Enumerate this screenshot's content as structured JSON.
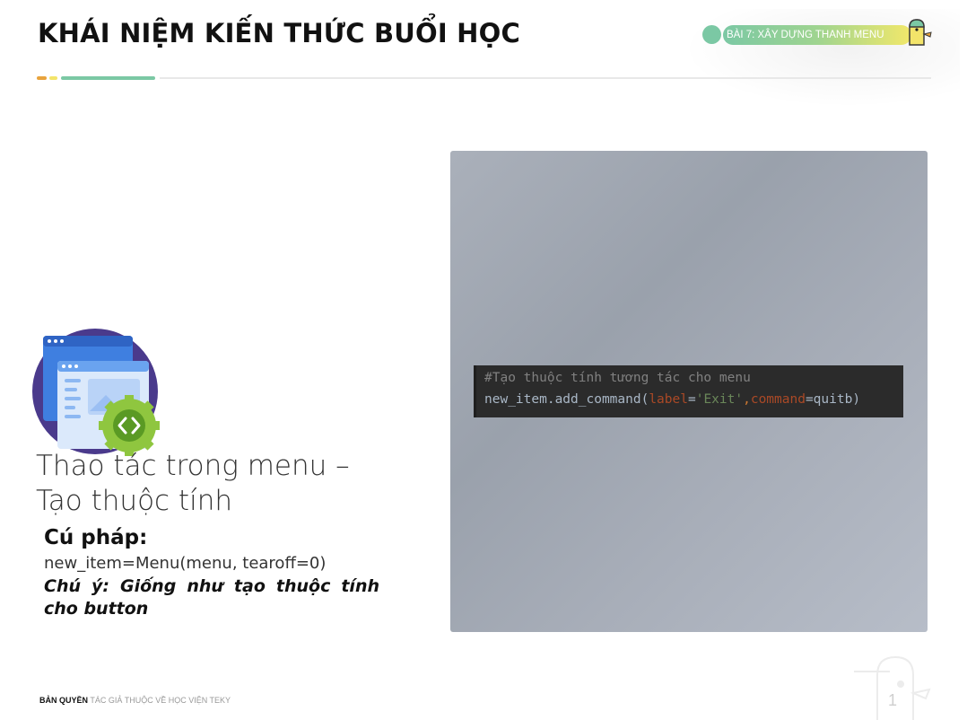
{
  "header": {
    "title": "KHÁI NIỆM KIẾN THỨC BUỔI HỌC",
    "badge": "BÀI 7: XÂY DỰNG THANH MENU"
  },
  "accents": [
    "#e8a33d",
    "#f3e46a",
    "#7bc8a4"
  ],
  "code": {
    "comment": "#Tạo thuộc tính tương tác cho menu",
    "line2": {
      "a": "new_item.add_command(",
      "b": "label",
      "c": "=",
      "d": "'Exit'",
      "e": ",",
      "f": "command",
      "g": "=quitb)"
    }
  },
  "content": {
    "icon": "web-code-icon",
    "heading_line1": "Thao tác trong menu –",
    "heading_line2": "Tạo thuộc tính",
    "syntax_label": "Cú pháp:",
    "syntax_code": "new_item=Menu(menu, tearoff=0)",
    "note": "Chú ý: Giống như tạo thuộc tính cho button"
  },
  "footer": {
    "strong": "BẢN QUYỀN",
    "light": "TÁC GIẢ THUỘC VỀ HỌC VIỆN TEKY",
    "page_number": "1"
  }
}
